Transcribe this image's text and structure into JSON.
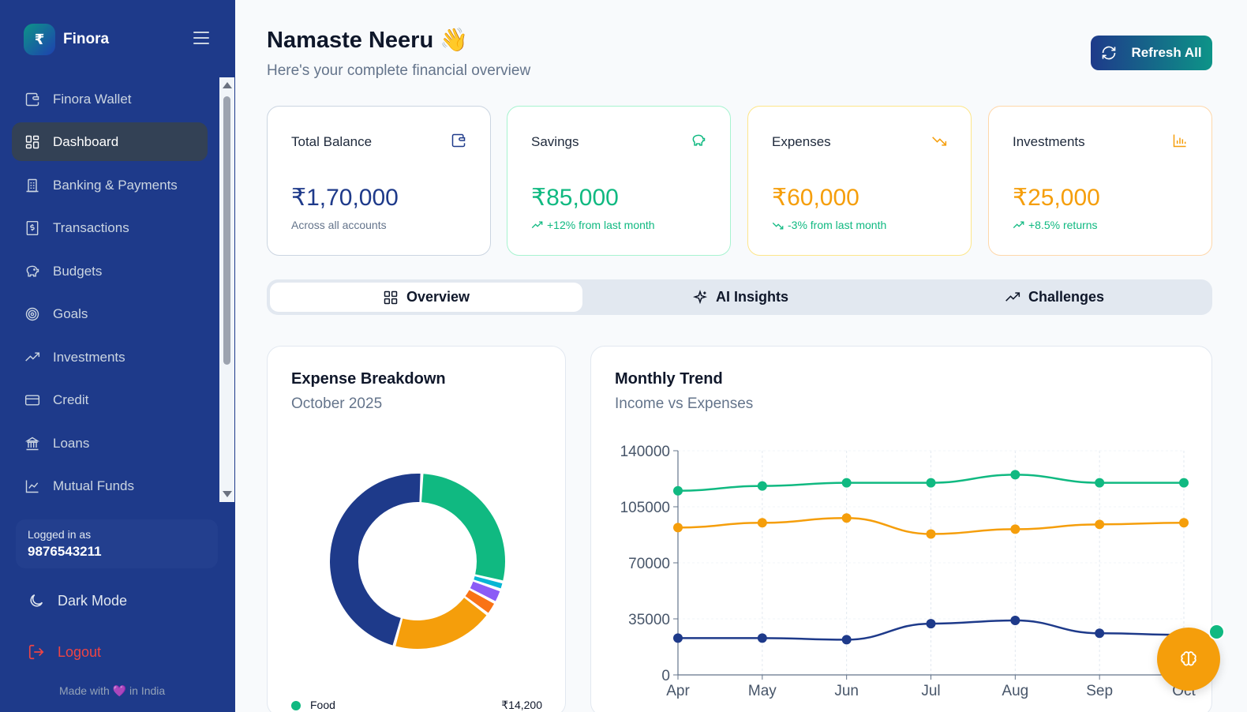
{
  "brand": {
    "logo": "₹",
    "name": "Finora"
  },
  "nav": [
    {
      "label": "Finora Wallet",
      "icon": "wallet-icon"
    },
    {
      "label": "Dashboard",
      "icon": "grid-icon",
      "active": true
    },
    {
      "label": "Banking & Payments",
      "icon": "building-icon"
    },
    {
      "label": "Transactions",
      "icon": "receipt-icon"
    },
    {
      "label": "Budgets",
      "icon": "piggy-bank-icon"
    },
    {
      "label": "Goals",
      "icon": "target-icon"
    },
    {
      "label": "Investments",
      "icon": "trending-up-icon"
    },
    {
      "label": "Credit",
      "icon": "credit-card-icon"
    },
    {
      "label": "Loans",
      "icon": "bank-icon"
    },
    {
      "label": "Mutual Funds",
      "icon": "line-chart-icon"
    }
  ],
  "user": {
    "label": "Logged in as",
    "phone": "9876543211"
  },
  "dark_mode_label": "Dark Mode",
  "logout_label": "Logout",
  "made_with": {
    "pre": "Made with",
    "heart": "💜",
    "post": "in India"
  },
  "header": {
    "greeting": "Namaste Neeru 👋",
    "subtitle": "Here's your complete financial overview",
    "refresh_label": "Refresh All"
  },
  "cards": [
    {
      "title": "Total Balance",
      "value": "₹1,70,000",
      "sub": "Across all accounts",
      "icon": "wallet-icon",
      "color": "#1e3a8a",
      "sub_color": "#64748b",
      "border": "#cbd5e1"
    },
    {
      "title": "Savings",
      "value": "₹85,000",
      "sub": "+12% from last month",
      "icon": "piggy-bank-icon",
      "color": "#10b981",
      "sub_color": "#10b981",
      "border": "#a7f3d0"
    },
    {
      "title": "Expenses",
      "value": "₹60,000",
      "sub": "-3% from last month",
      "icon": "trending-down-icon",
      "color": "#f59e0b",
      "sub_color": "#10b981",
      "border": "#fde68a"
    },
    {
      "title": "Investments",
      "value": "₹25,000",
      "sub": "+8.5% returns",
      "icon": "bar-chart-icon",
      "color": "#f59e0b",
      "sub_color": "#10b981",
      "border": "#fed7aa"
    }
  ],
  "tabs": [
    {
      "label": "Overview",
      "icon": "grid-icon",
      "active": true
    },
    {
      "label": "AI Insights",
      "icon": "sparkles-icon"
    },
    {
      "label": "Challenges",
      "icon": "trending-up-icon"
    }
  ],
  "expense_panel": {
    "title": "Expense Breakdown",
    "subtitle": "October 2025",
    "legend_first": {
      "label": "Food",
      "value": "₹14,200"
    }
  },
  "trend_panel": {
    "title": "Monthly Trend",
    "subtitle": "Income vs Expenses"
  },
  "colors": {
    "sidebar": "#1e3a8a",
    "green": "#10b981",
    "orange": "#f59e0b",
    "navy": "#1e3a8a"
  },
  "chart_data": [
    {
      "type": "pie",
      "title": "Expense Breakdown",
      "subtitle": "October 2025",
      "slices": [
        {
          "name": "Food",
          "value": 28,
          "color": "#10b981"
        },
        {
          "name": "",
          "value": 1.5,
          "color": "#06b6d4"
        },
        {
          "name": "",
          "value": 2.5,
          "color": "#8b5cf6"
        },
        {
          "name": "",
          "value": 2.5,
          "color": "#f97316"
        },
        {
          "name": "",
          "value": 19,
          "color": "#f59e0b"
        },
        {
          "name": "",
          "value": 46.5,
          "color": "#1e3a8a"
        }
      ]
    },
    {
      "type": "line",
      "title": "Monthly Trend",
      "subtitle": "Income vs Expenses",
      "categories": [
        "Apr",
        "May",
        "Jun",
        "Jul",
        "Aug",
        "Sep",
        "Oct"
      ],
      "yticks": [
        "140000",
        "105000",
        "70000",
        "35000",
        "0"
      ],
      "ylim": [
        0,
        140000
      ],
      "series": [
        {
          "values": [
            115000,
            118000,
            120000,
            120000,
            125000,
            120000,
            120000
          ],
          "color": "#10b981"
        },
        {
          "values": [
            92000,
            95000,
            98000,
            88000,
            91000,
            94000,
            95000
          ],
          "color": "#f59e0b"
        },
        {
          "values": [
            23000,
            23000,
            22000,
            32000,
            34000,
            26000,
            25000
          ],
          "color": "#1e3a8a"
        }
      ]
    }
  ]
}
